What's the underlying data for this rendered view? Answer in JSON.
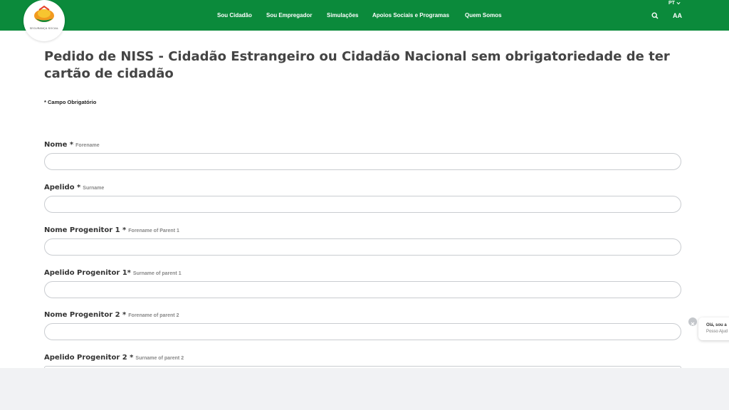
{
  "header": {
    "logo_text": "SEGURANÇA SOCIAL",
    "nav": [
      "Sou Cidadão",
      "Sou Empregador",
      "Simulações",
      "Apoios Sociais e Programas",
      "Quem Somos"
    ],
    "language": "PT",
    "font_size_toggle": "AA",
    "search_icon": "search-icon",
    "background_color": "#0b8a3b"
  },
  "page": {
    "title": "Pedido de NISS - Cidadão Estrangeiro ou Cidadão Nacional sem obrigatoriedade de ter cartão de cidadão",
    "required_note": "* Campo Obrigatório"
  },
  "form": {
    "fields": [
      {
        "label": "Nome *",
        "hint": "Forename",
        "value": ""
      },
      {
        "label": "Apelido *",
        "hint": "Surname",
        "value": ""
      },
      {
        "label": "Nome Progenitor 1 *",
        "hint": "Forename of Parent 1",
        "value": ""
      },
      {
        "label": "Apelido Progenitor 1*",
        "hint": "Surname of parent 1",
        "value": ""
      },
      {
        "label": "Nome Progenitor 2 *",
        "hint": "Forename of parent 2",
        "value": ""
      },
      {
        "label": "Apelido Progenitor 2 *",
        "hint": "Surname of parent 2",
        "value": ""
      }
    ]
  },
  "chat": {
    "line1": "Olá, sou a",
    "line2": "Posso Ajud"
  }
}
